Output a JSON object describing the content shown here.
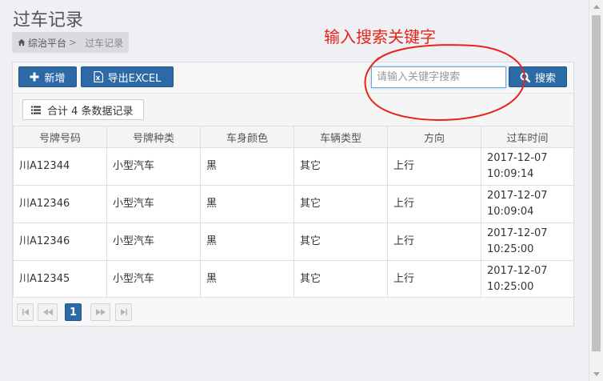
{
  "page": {
    "title": "过车记录",
    "breadcrumb": {
      "home": "综治平台",
      "separator": ">",
      "current": "过车记录"
    }
  },
  "annotation": {
    "text": "输入搜索关键字",
    "color": "#e8231a"
  },
  "toolbar": {
    "add_label": "新增",
    "export_label": "导出EXCEL",
    "search_placeholder": "请输入关键字搜索",
    "search_value": "",
    "search_label": "搜索",
    "accent_color": "#2c6aa7"
  },
  "summary": {
    "text": "合计 4 条数据记录",
    "icon": "list-icon"
  },
  "table": {
    "headers": [
      "号牌号码",
      "号牌种类",
      "车身颜色",
      "车辆类型",
      "方向",
      "过车时间"
    ],
    "rows": [
      {
        "plate": "川A12344",
        "plate_type": "小型汽车",
        "color": "黑",
        "vehicle_type": "其它",
        "direction": "上行",
        "date": "2017-12-07",
        "time": "10:09:14"
      },
      {
        "plate": "川A12346",
        "plate_type": "小型汽车",
        "color": "黑",
        "vehicle_type": "其它",
        "direction": "上行",
        "date": "2017-12-07",
        "time": "10:09:04"
      },
      {
        "plate": "川A12346",
        "plate_type": "小型汽车",
        "color": "黑",
        "vehicle_type": "其它",
        "direction": "上行",
        "date": "2017-12-07",
        "time": "10:25:00"
      },
      {
        "plate": "川A12345",
        "plate_type": "小型汽车",
        "color": "黑",
        "vehicle_type": "其它",
        "direction": "上行",
        "date": "2017-12-07",
        "time": "10:25:00"
      }
    ]
  },
  "pager": {
    "current_page": "1",
    "icons": [
      "first-page-icon",
      "prev-page-icon",
      "next-page-icon",
      "last-page-icon"
    ]
  }
}
